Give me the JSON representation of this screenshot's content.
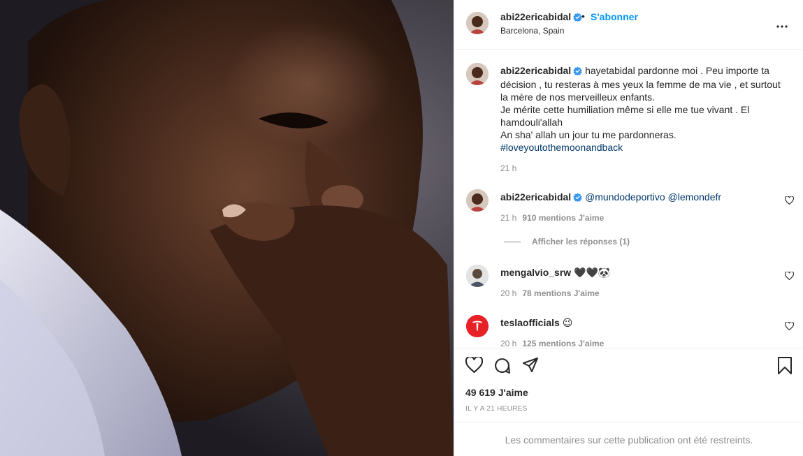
{
  "post": {
    "username": "abi22ericabidal",
    "separator": "•",
    "follow_label": "S'abonner",
    "location": "Barcelona, Spain"
  },
  "caption": {
    "username": "abi22ericabidal",
    "text_line1": "hayetabidal pardonne moi . Peu importe ta décision , tu resteras à mes yeux la femme de ma vie , et surtout la mère de nos merveilleux enfants.",
    "text_line2": "Je mérite cette humiliation même si elle me tue vivant . El hamdouli'allah",
    "text_line3": "An sha' allah un jour tu me pardonneras.",
    "hashtag": "#loveyoutothemoonandback",
    "time": "21 h"
  },
  "comments": [
    {
      "username": "abi22ericabidal",
      "text_tag1": "@mundodeportivo",
      "text_tag2": "@lemondefr",
      "time": "21 h",
      "likes": "910 mentions J'aime"
    },
    {
      "username": "mengalvio_srw",
      "text": "🖤🖤🐼",
      "time": "20 h",
      "likes": "78 mentions J'aime"
    },
    {
      "username": "teslaofficials",
      "text": "😉",
      "time": "20 h",
      "likes": "125 mentions J'aime"
    }
  ],
  "replies_label": "Afficher les réponses (1)",
  "likes_count": "49 619 J'aime",
  "time_ago": "IL Y A 21 HEURES",
  "restricted_notice": "Les commentaires sur cette publication ont été restreints.",
  "colors": {
    "accent": "#0095f6",
    "verified": "#3897f0",
    "link": "#00376b",
    "muted": "#8e8e8e",
    "tesla": "#e82127"
  },
  "icons": [
    "verified-icon",
    "more-options-icon",
    "heart-icon",
    "comment-icon",
    "share-icon",
    "bookmark-icon"
  ]
}
